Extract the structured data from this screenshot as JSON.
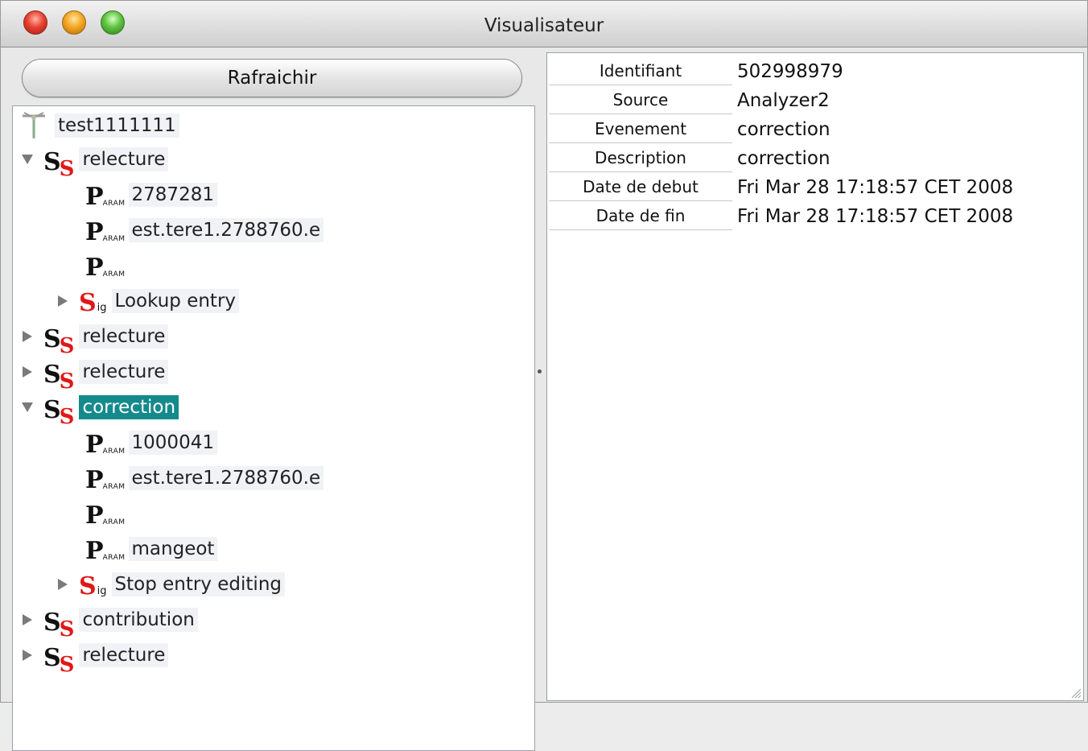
{
  "window": {
    "title": "Visualisateur"
  },
  "toolbar": {
    "refresh_label": "Rafraichir"
  },
  "tree": {
    "root": "test1111111",
    "n1": "relecture",
    "n1_p1": "2787281",
    "n1_p2": "est.tere1.2788760.e",
    "n1_p3": "",
    "n1_sig": "Lookup entry",
    "n2": "relecture",
    "n3": "relecture",
    "n4": "correction",
    "n4_p1": "1000041",
    "n4_p2": "est.tere1.2788760.e",
    "n4_p3": "",
    "n4_p4": "mangeot",
    "n4_sig": "Stop entry editing",
    "n5": "contribution",
    "n6": "relecture",
    "selected": "correction"
  },
  "properties": [
    {
      "key": "Identifiant",
      "value": "502998979"
    },
    {
      "key": "Source",
      "value": "Analyzer2"
    },
    {
      "key": "Evenement",
      "value": "correction"
    },
    {
      "key": "Description",
      "value": "correction"
    },
    {
      "key": "Date de debut",
      "value": "Fri Mar 28 17:18:57 CET 2008"
    },
    {
      "key": "Date de fin",
      "value": "Fri Mar 28 17:18:57 CET 2008"
    }
  ],
  "icons": {
    "state": "ss-state-icon",
    "param": "param-icon",
    "signal": "sig-signal-icon",
    "root": "antenna-root-icon",
    "expanded": "triangle-down-icon",
    "collapsed": "triangle-right-icon"
  },
  "colors": {
    "selection": "#148a8c",
    "icon_red": "#e01818"
  }
}
